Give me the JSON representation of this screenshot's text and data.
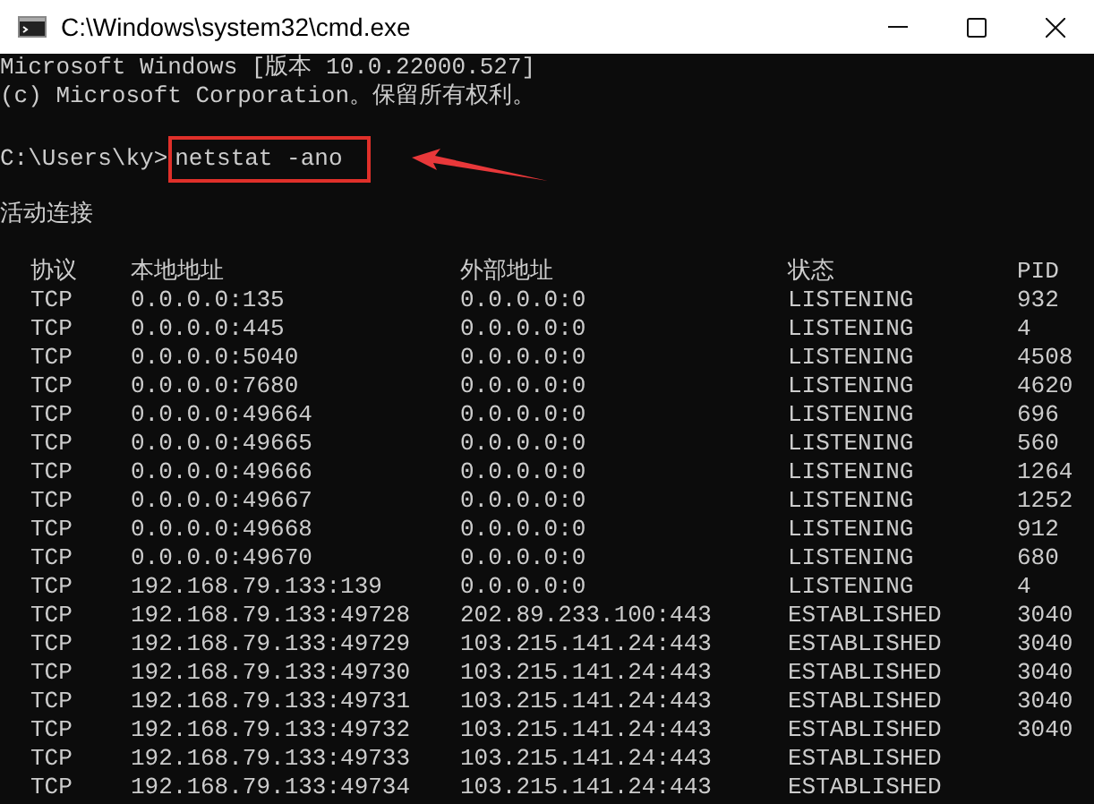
{
  "window": {
    "title": "C:\\Windows\\system32\\cmd.exe"
  },
  "console": {
    "lines": [
      "Microsoft Windows [版本 10.0.22000.527]",
      "(c) Microsoft Corporation。保留所有权利。"
    ],
    "prompt": "C:\\Users\\ky>",
    "command": "netstat -ano",
    "section_title": "活动连接",
    "table": {
      "columns": [
        "协议",
        "本地地址",
        "外部地址",
        "状态",
        "PID"
      ],
      "rows": [
        [
          "TCP",
          "0.0.0.0:135",
          "0.0.0.0:0",
          "LISTENING",
          "932"
        ],
        [
          "TCP",
          "0.0.0.0:445",
          "0.0.0.0:0",
          "LISTENING",
          "4"
        ],
        [
          "TCP",
          "0.0.0.0:5040",
          "0.0.0.0:0",
          "LISTENING",
          "4508"
        ],
        [
          "TCP",
          "0.0.0.0:7680",
          "0.0.0.0:0",
          "LISTENING",
          "4620"
        ],
        [
          "TCP",
          "0.0.0.0:49664",
          "0.0.0.0:0",
          "LISTENING",
          "696"
        ],
        [
          "TCP",
          "0.0.0.0:49665",
          "0.0.0.0:0",
          "LISTENING",
          "560"
        ],
        [
          "TCP",
          "0.0.0.0:49666",
          "0.0.0.0:0",
          "LISTENING",
          "1264"
        ],
        [
          "TCP",
          "0.0.0.0:49667",
          "0.0.0.0:0",
          "LISTENING",
          "1252"
        ],
        [
          "TCP",
          "0.0.0.0:49668",
          "0.0.0.0:0",
          "LISTENING",
          "912"
        ],
        [
          "TCP",
          "0.0.0.0:49670",
          "0.0.0.0:0",
          "LISTENING",
          "680"
        ],
        [
          "TCP",
          "192.168.79.133:139",
          "0.0.0.0:0",
          "LISTENING",
          "4"
        ],
        [
          "TCP",
          "192.168.79.133:49728",
          "202.89.233.100:443",
          "ESTABLISHED",
          "3040"
        ],
        [
          "TCP",
          "192.168.79.133:49729",
          "103.215.141.24:443",
          "ESTABLISHED",
          "3040"
        ],
        [
          "TCP",
          "192.168.79.133:49730",
          "103.215.141.24:443",
          "ESTABLISHED",
          "3040"
        ],
        [
          "TCP",
          "192.168.79.133:49731",
          "103.215.141.24:443",
          "ESTABLISHED",
          "3040"
        ],
        [
          "TCP",
          "192.168.79.133:49732",
          "103.215.141.24:443",
          "ESTABLISHED",
          "3040"
        ],
        [
          "TCP",
          "192.168.79.133:49733",
          "103.215.141.24:443",
          "ESTABLISHED"
        ],
        [
          "TCP",
          "192.168.79.133:49734",
          "103.215.141.24:443",
          "ESTABLISHED"
        ]
      ]
    }
  }
}
